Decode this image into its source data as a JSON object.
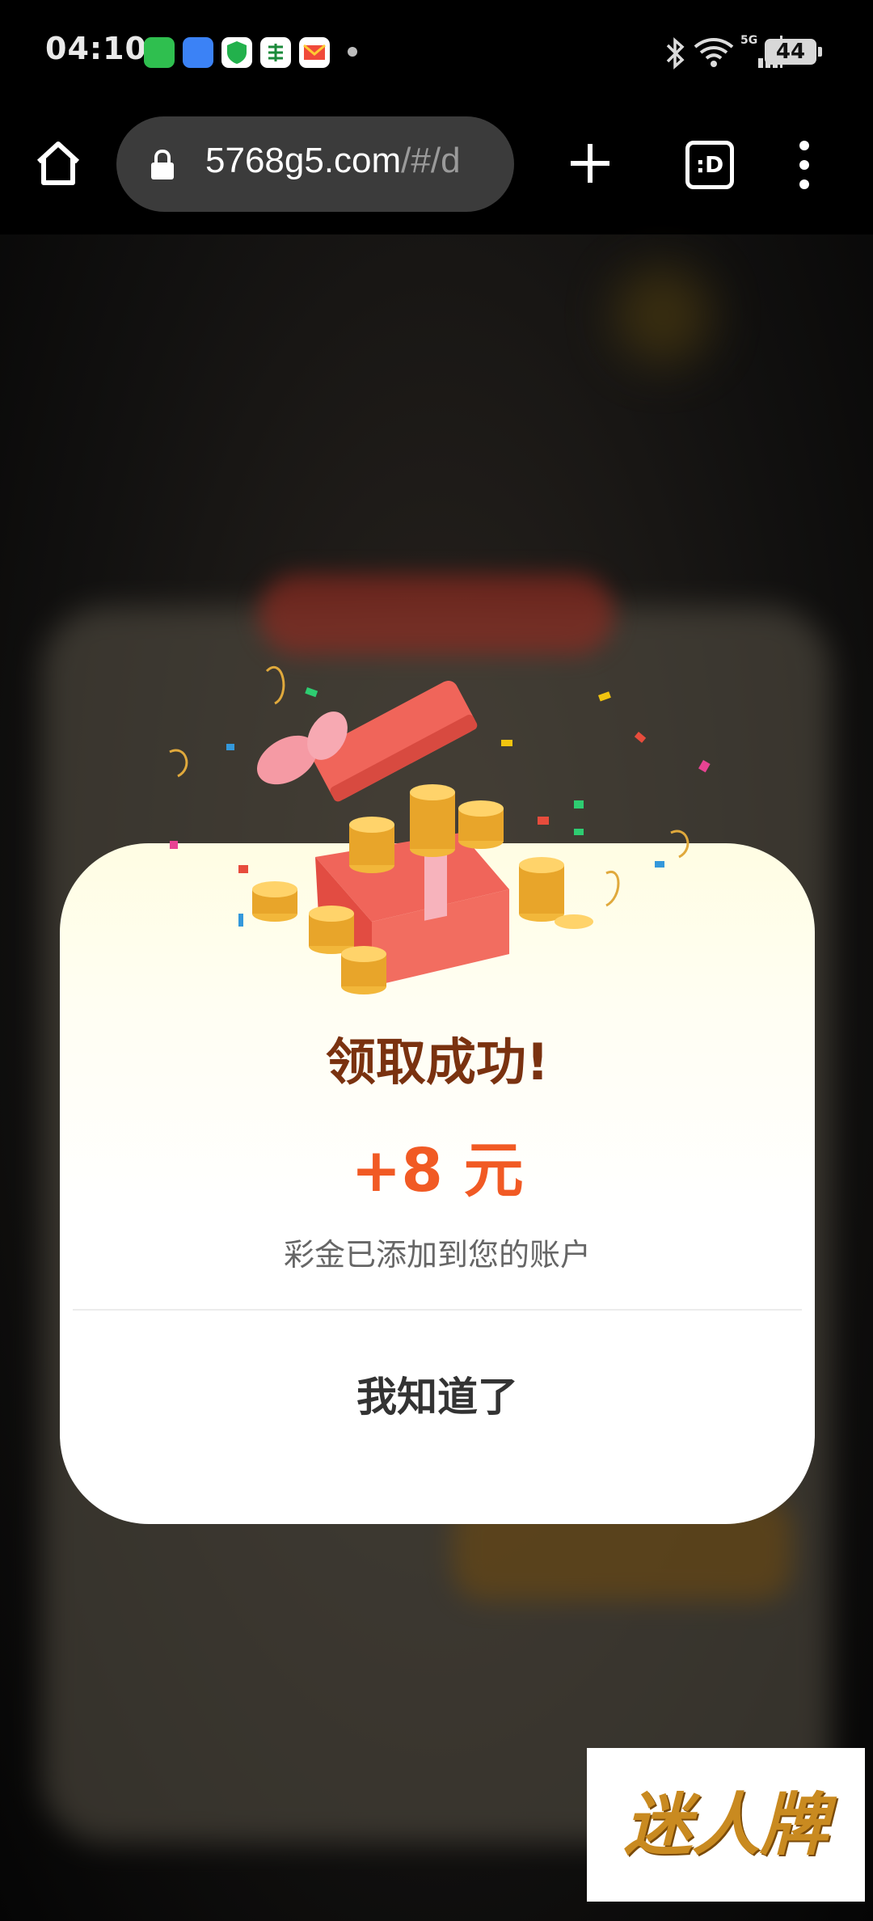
{
  "status_bar": {
    "time": "04:10",
    "battery": "44",
    "network": "5G"
  },
  "browser": {
    "url_domain": "5768g5.com",
    "url_path": "/#/d",
    "tabs_label": ":D"
  },
  "dialog": {
    "title": "领取成功!",
    "amount": "+8 元",
    "description": "彩金已添加到您的账户",
    "confirm_button": "我知道了"
  },
  "watermark": {
    "text": "迷人牌"
  },
  "colors": {
    "title": "#7a3210",
    "amount": "#f15a24",
    "url_bar": "#3b3b3b"
  }
}
